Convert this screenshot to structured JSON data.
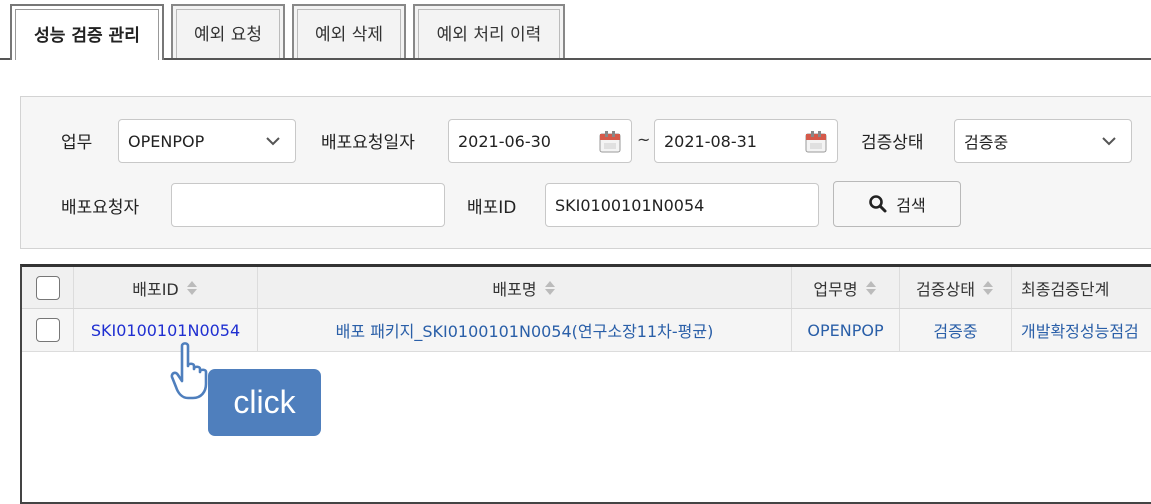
{
  "tabs": [
    {
      "label": "성능 검증 관리",
      "active": true
    },
    {
      "label": "예외 요청",
      "active": false
    },
    {
      "label": "예외 삭제",
      "active": false
    },
    {
      "label": "예외 처리 이력",
      "active": false
    }
  ],
  "search": {
    "business_label": "업무",
    "business_value": "OPENPOP",
    "request_date_label": "배포요청일자",
    "date_from": "2021-06-30",
    "date_tilde": "~",
    "date_to": "2021-08-31",
    "status_label": "검증상태",
    "status_value": "검증중",
    "requester_label": "배포요청자",
    "requester_value": "",
    "deploy_id_label": "배포ID",
    "deploy_id_value": "SKI0100101N0054",
    "search_button_label": "검색"
  },
  "grid": {
    "columns": [
      "배포ID",
      "배포명",
      "업무명",
      "검증상태",
      "최종검증단계"
    ],
    "rows": [
      {
        "deploy_id": "SKI0100101N0054",
        "deploy_name": "배포 패키지_SKI0100101N0054(연구소장11차-평균)",
        "business_name": "OPENPOP",
        "status": "검증중",
        "final_stage": "개발확정성능점검"
      }
    ]
  },
  "overlay": {
    "click_label": "click"
  },
  "icons": {
    "dropdown": "chevron-down-icon",
    "calendar": "calendar-icon",
    "search": "search-icon",
    "sort": "sort-icon",
    "cursor": "hand-pointer-icon"
  },
  "colors": {
    "link": "#1f2fd1",
    "cell_text": "#2a5fa8",
    "badge": "#4f7fbd"
  }
}
